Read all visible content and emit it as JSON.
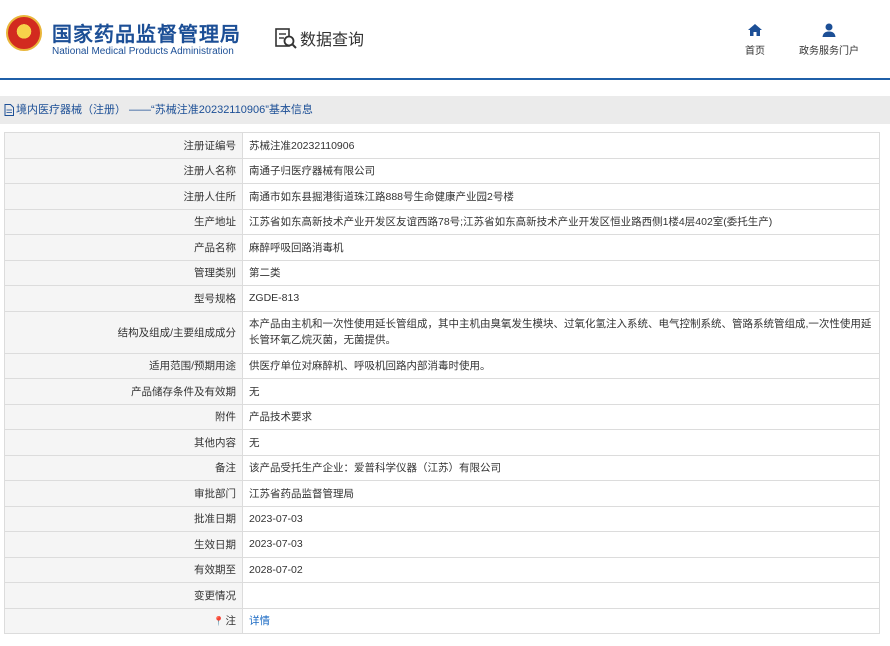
{
  "header": {
    "org_cn": "国家药品监督管理局",
    "org_en": "National Medical Products Administration",
    "query_label": "数据查询",
    "emblem_icon": "national-emblem",
    "query_icon": "document-search-icon",
    "nav": [
      {
        "label": "首页",
        "icon": "home-icon"
      },
      {
        "label": "政务服务门户",
        "icon": "user-icon"
      }
    ],
    "brand_color": "#1c4f96"
  },
  "breadcrumb": {
    "text": "境内医疗器械（注册） ——“苏械注准20232110906”基本信息",
    "icon": "document-icon"
  },
  "table": {
    "rows": [
      {
        "key": "注册证编号",
        "value": "苏械注准20232110906"
      },
      {
        "key": "注册人名称",
        "value": "南通子归医疗器械有限公司"
      },
      {
        "key": "注册人住所",
        "value": "南通市如东县掘港街道珠江路888号生命健康产业园2号楼"
      },
      {
        "key": "生产地址",
        "value": "江苏省如东高新技术产业开发区友谊西路78号;江苏省如东高新技术产业开发区恒业路西侧1楼4层402室(委托生产)"
      },
      {
        "key": "产品名称",
        "value": "麻醉呼吸回路消毒机"
      },
      {
        "key": "管理类别",
        "value": "第二类"
      },
      {
        "key": "型号规格",
        "value": "ZGDE-813"
      },
      {
        "key": "结构及组成/主要组成成分",
        "value": "本产品由主机和一次性使用延长管组成，其中主机由臭氧发生模块、过氧化氢注入系统、电气控制系统、管路系统管组成,一次性使用延长管环氧乙烷灭菌，无菌提供。"
      },
      {
        "key": "适用范围/预期用途",
        "value": "供医疗单位对麻醉机、呼吸机回路内部消毒时使用。"
      },
      {
        "key": "产品储存条件及有效期",
        "value": "无"
      },
      {
        "key": "附件",
        "value": "产品技术要求"
      },
      {
        "key": "其他内容",
        "value": "无"
      },
      {
        "key": "备注",
        "value": "该产品受托生产企业：爱普科学仪器（江苏）有限公司"
      },
      {
        "key": "审批部门",
        "value": "江苏省药品监督管理局"
      },
      {
        "key": "批准日期",
        "value": "2023-07-03"
      },
      {
        "key": "生效日期",
        "value": "2023-07-03"
      },
      {
        "key": "有效期至",
        "value": "2028-07-02"
      },
      {
        "key": "变更情况",
        "value": ""
      },
      {
        "key": "注",
        "value": "详情",
        "icon": "location-pin-icon"
      }
    ]
  }
}
